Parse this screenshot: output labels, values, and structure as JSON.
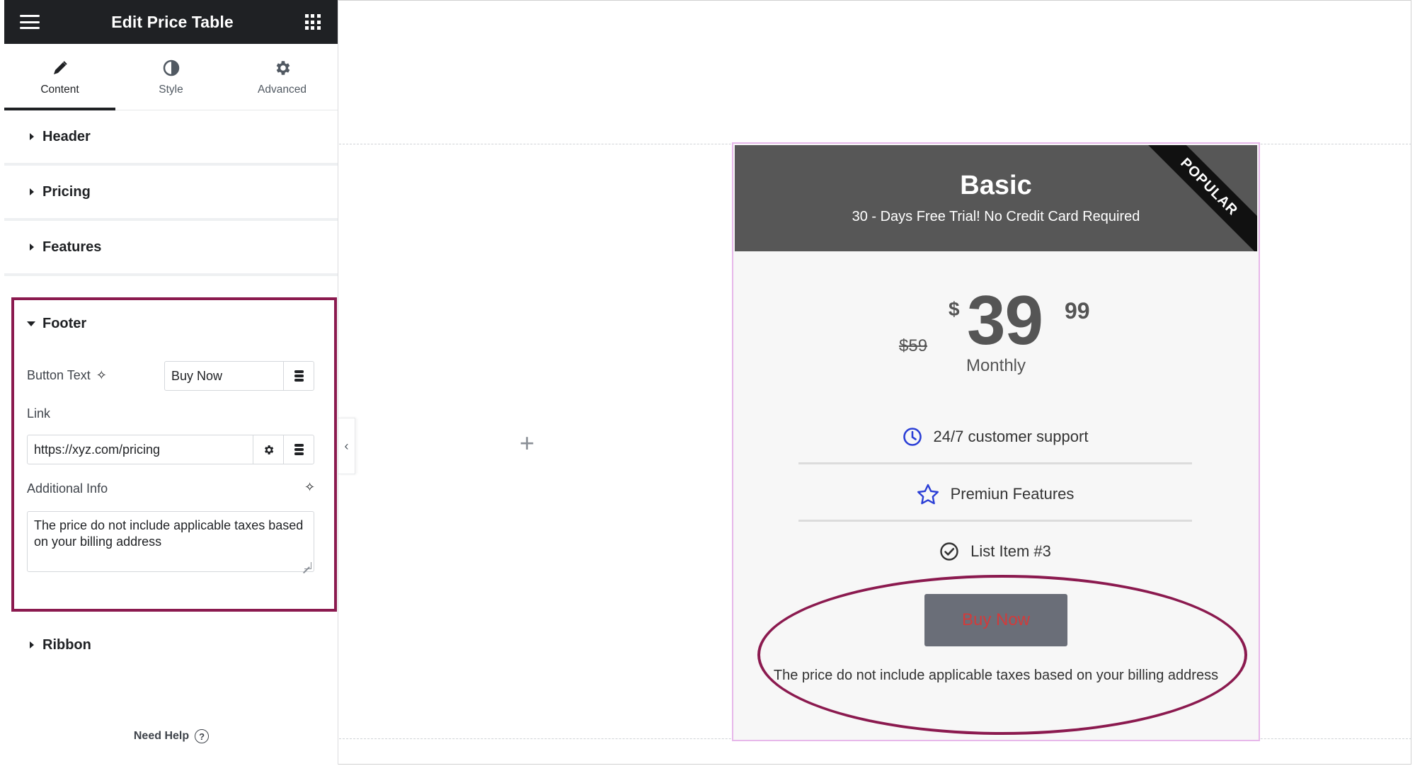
{
  "panel": {
    "title": "Edit Price Table",
    "tabs": [
      {
        "label": "Content",
        "icon": "pencil-icon"
      },
      {
        "label": "Style",
        "icon": "half-circle-icon"
      },
      {
        "label": "Advanced",
        "icon": "gear-icon"
      }
    ],
    "sections": {
      "header": "Header",
      "pricing": "Pricing",
      "features": "Features",
      "footer": "Footer",
      "ribbon": "Ribbon"
    },
    "footer": {
      "button_text_label": "Button Text",
      "button_text_value": "Buy Now",
      "link_label": "Link",
      "link_value": "https://xyz.com/pricing",
      "additional_info_label": "Additional Info",
      "additional_info_value": "The price do not include applicable taxes based on your billing address"
    },
    "need_help": "Need Help"
  },
  "price_card": {
    "title": "Basic",
    "subtitle": "30 - Days Free Trial! No Credit Card Required",
    "ribbon": "POPULAR",
    "old_price": "$59",
    "currency": "$",
    "price_integer": "39",
    "price_fraction": "99",
    "period": "Monthly",
    "features": [
      {
        "text": "24/7 customer support",
        "icon": "clock-icon"
      },
      {
        "text": "Premiun Features",
        "icon": "star-icon"
      },
      {
        "text": "List Item #3",
        "icon": "check-circle-icon"
      }
    ],
    "button_label": "Buy Now",
    "additional_info": "The price do not include applicable taxes based on your billing address"
  },
  "colors": {
    "highlight": "#8b1a4f",
    "header_bg": "#575757",
    "icon_blue": "#2b3fd6",
    "button_bg": "#6a6e78",
    "button_text": "#d23b3b"
  }
}
